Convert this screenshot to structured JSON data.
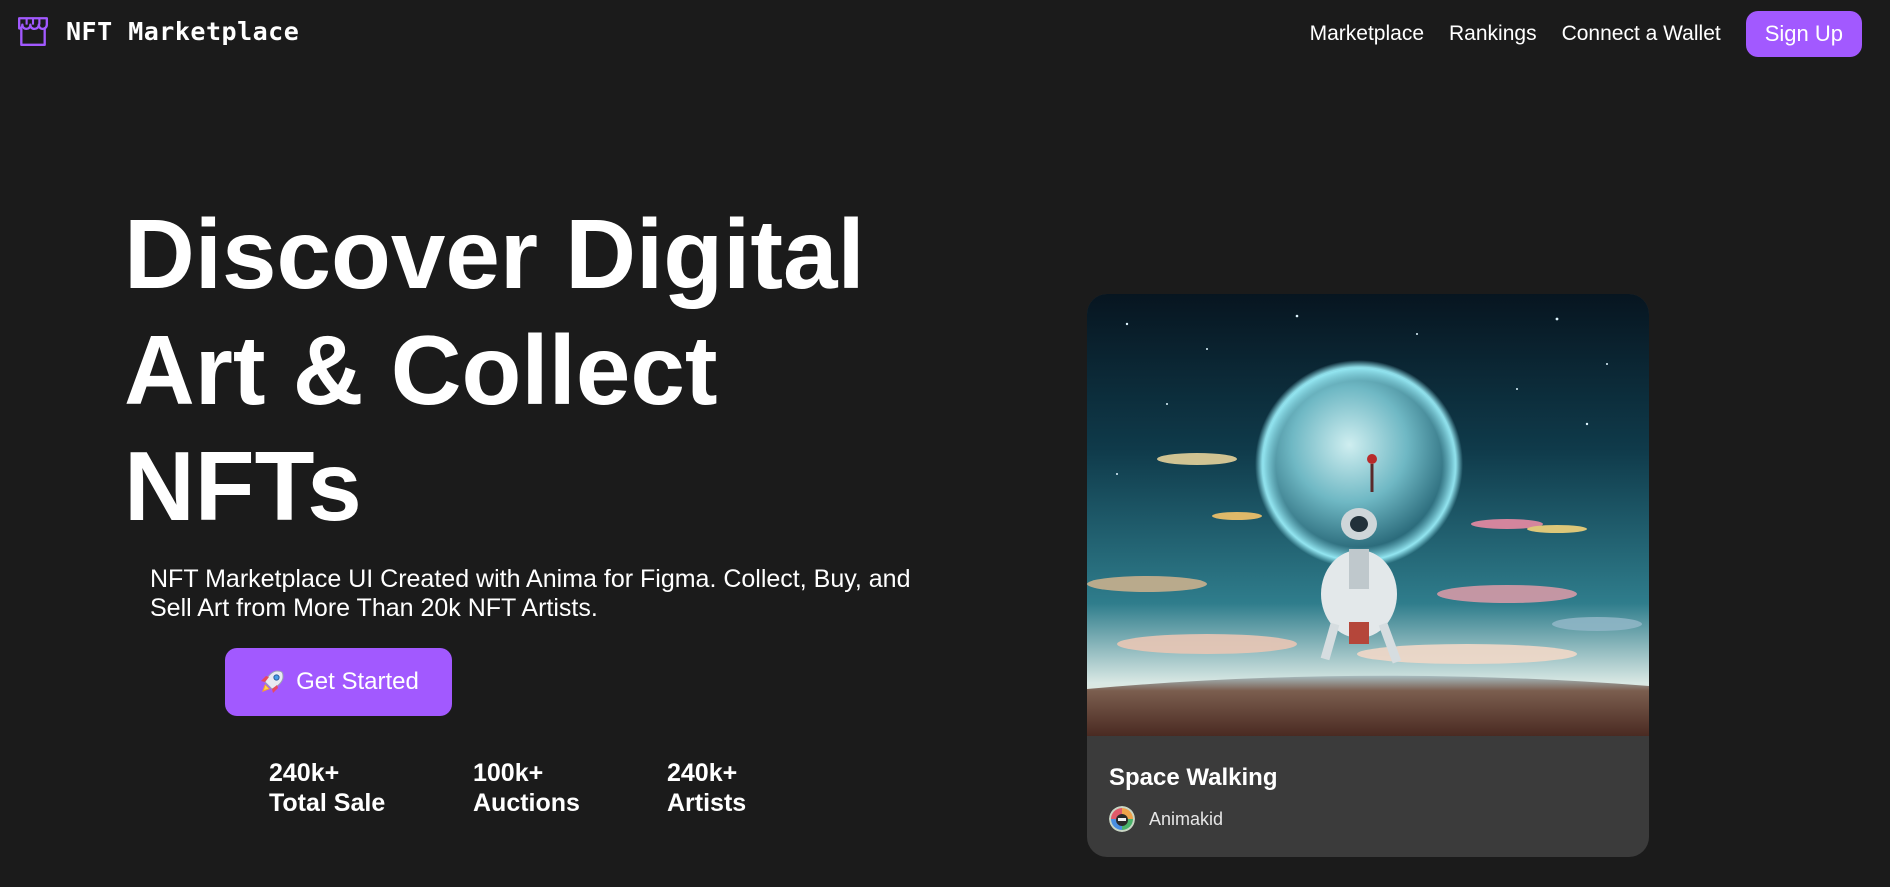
{
  "header": {
    "logo_text": "NFT Marketplace",
    "logo_icon": "storefront-icon",
    "nav": [
      {
        "label": "Marketplace"
      },
      {
        "label": "Rankings"
      },
      {
        "label": "Connect a Wallet"
      }
    ],
    "signup_label": "Sign Up"
  },
  "hero": {
    "title": "Discover Digital Art & Collect NFTs",
    "subtitle": "NFT Marketplace UI Created with Anima for Figma. Collect, Buy, and Sell Art from More Than 20k NFT Artists.",
    "cta_label": "Get Started",
    "cta_icon": "rocket-icon",
    "stats": [
      {
        "value": "240k+",
        "label": "Total Sale"
      },
      {
        "value": "100k+",
        "label": "Auctions"
      },
      {
        "value": "240k+",
        "label": "Artists"
      }
    ]
  },
  "card": {
    "title": "Space Walking",
    "artist": "Animakid",
    "artist_icon": "artist-avatar"
  },
  "colors": {
    "background": "#1b1b1b",
    "accent": "#a259ff",
    "card_background": "#3b3b3b",
    "text": "#ffffff"
  }
}
